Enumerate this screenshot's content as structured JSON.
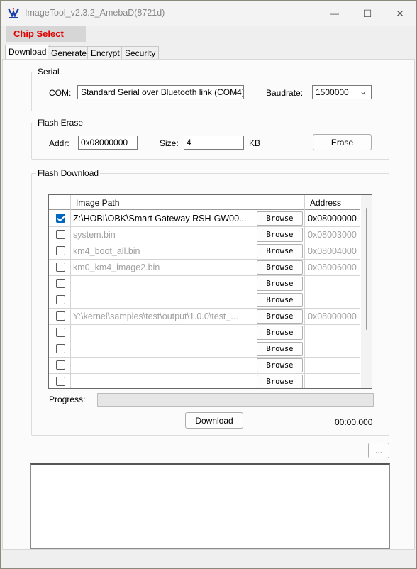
{
  "window": {
    "title": "ImageTool_v2.3.2_AmebaD(8721d)",
    "minimize_glyph": "—",
    "maximize_glyph": "☐",
    "close_glyph": "✕"
  },
  "chip_select_label": "Chip Select",
  "tabs": [
    {
      "label": "Download",
      "active": true
    },
    {
      "label": "Generate",
      "active": false
    },
    {
      "label": "Encrypt",
      "active": false
    },
    {
      "label": "Security",
      "active": false
    }
  ],
  "serial": {
    "group_title": "Serial",
    "com_label": "COM:",
    "com_value": "Standard Serial over Bluetooth link (COM4)",
    "baudrate_label": "Baudrate:",
    "baudrate_value": "1500000"
  },
  "flash_erase": {
    "group_title": "Flash Erase",
    "addr_label": "Addr:",
    "addr_value": "0x08000000",
    "size_label": "Size:",
    "size_value": "4",
    "unit_label": "KB",
    "erase_button": "Erase"
  },
  "flash_download": {
    "group_title": "Flash Download",
    "columns": {
      "image_path": "Image Path",
      "address": "Address"
    },
    "browse_label": "Browse",
    "rows": [
      {
        "checked": true,
        "path": "Z:\\HOBI\\OBK\\Smart Gateway RSH-GW00...",
        "address": "0x08000000",
        "dim": false
      },
      {
        "checked": false,
        "path": "system.bin",
        "address": "0x08003000",
        "dim": true
      },
      {
        "checked": false,
        "path": "km4_boot_all.bin",
        "address": "0x08004000",
        "dim": true
      },
      {
        "checked": false,
        "path": "km0_km4_image2.bin",
        "address": "0x08006000",
        "dim": true
      },
      {
        "checked": false,
        "path": "",
        "address": "",
        "dim": true
      },
      {
        "checked": false,
        "path": "",
        "address": "",
        "dim": true
      },
      {
        "checked": false,
        "path": "Y:\\kernel\\samples\\test\\output\\1.0.0\\test_...",
        "address": "0x08000000",
        "dim": true
      },
      {
        "checked": false,
        "path": "",
        "address": "",
        "dim": true
      },
      {
        "checked": false,
        "path": "",
        "address": "",
        "dim": true
      },
      {
        "checked": false,
        "path": "",
        "address": "",
        "dim": true
      },
      {
        "checked": false,
        "path": "",
        "address": "",
        "dim": true
      }
    ],
    "progress_label": "Progress:",
    "progress_value": 0,
    "download_button": "Download",
    "elapsed": "00:00.000"
  },
  "more_button": "...",
  "log_text": ""
}
